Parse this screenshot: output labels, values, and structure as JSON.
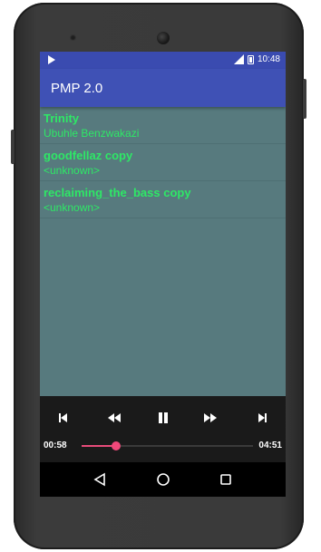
{
  "status_bar": {
    "time": "10:48",
    "icons": [
      "play-icon",
      "signal-icon",
      "battery-icon"
    ]
  },
  "app_bar": {
    "title": "PMP 2.0"
  },
  "tracks": [
    {
      "title": "Trinity",
      "artist": "Ubuhle Benzwakazi"
    },
    {
      "title": "goodfellaz copy",
      "artist": "<unknown>"
    },
    {
      "title": "reclaiming_the_bass copy",
      "artist": "<unknown>"
    }
  ],
  "player": {
    "current_time": "00:58",
    "total_time": "04:51",
    "progress_fraction": 0.2,
    "controls": [
      "skip-previous-icon",
      "rewind-icon",
      "pause-icon",
      "fast-forward-icon",
      "skip-next-icon"
    ]
  },
  "nav_bar": {
    "buttons": [
      "back-icon",
      "home-icon",
      "recents-icon"
    ]
  },
  "colors": {
    "app_bar": "#3f51b5",
    "status_bar": "#3a4bb0",
    "list_background": "#577a7e",
    "track_text": "#2ee866",
    "seek_accent": "#f0487a"
  }
}
